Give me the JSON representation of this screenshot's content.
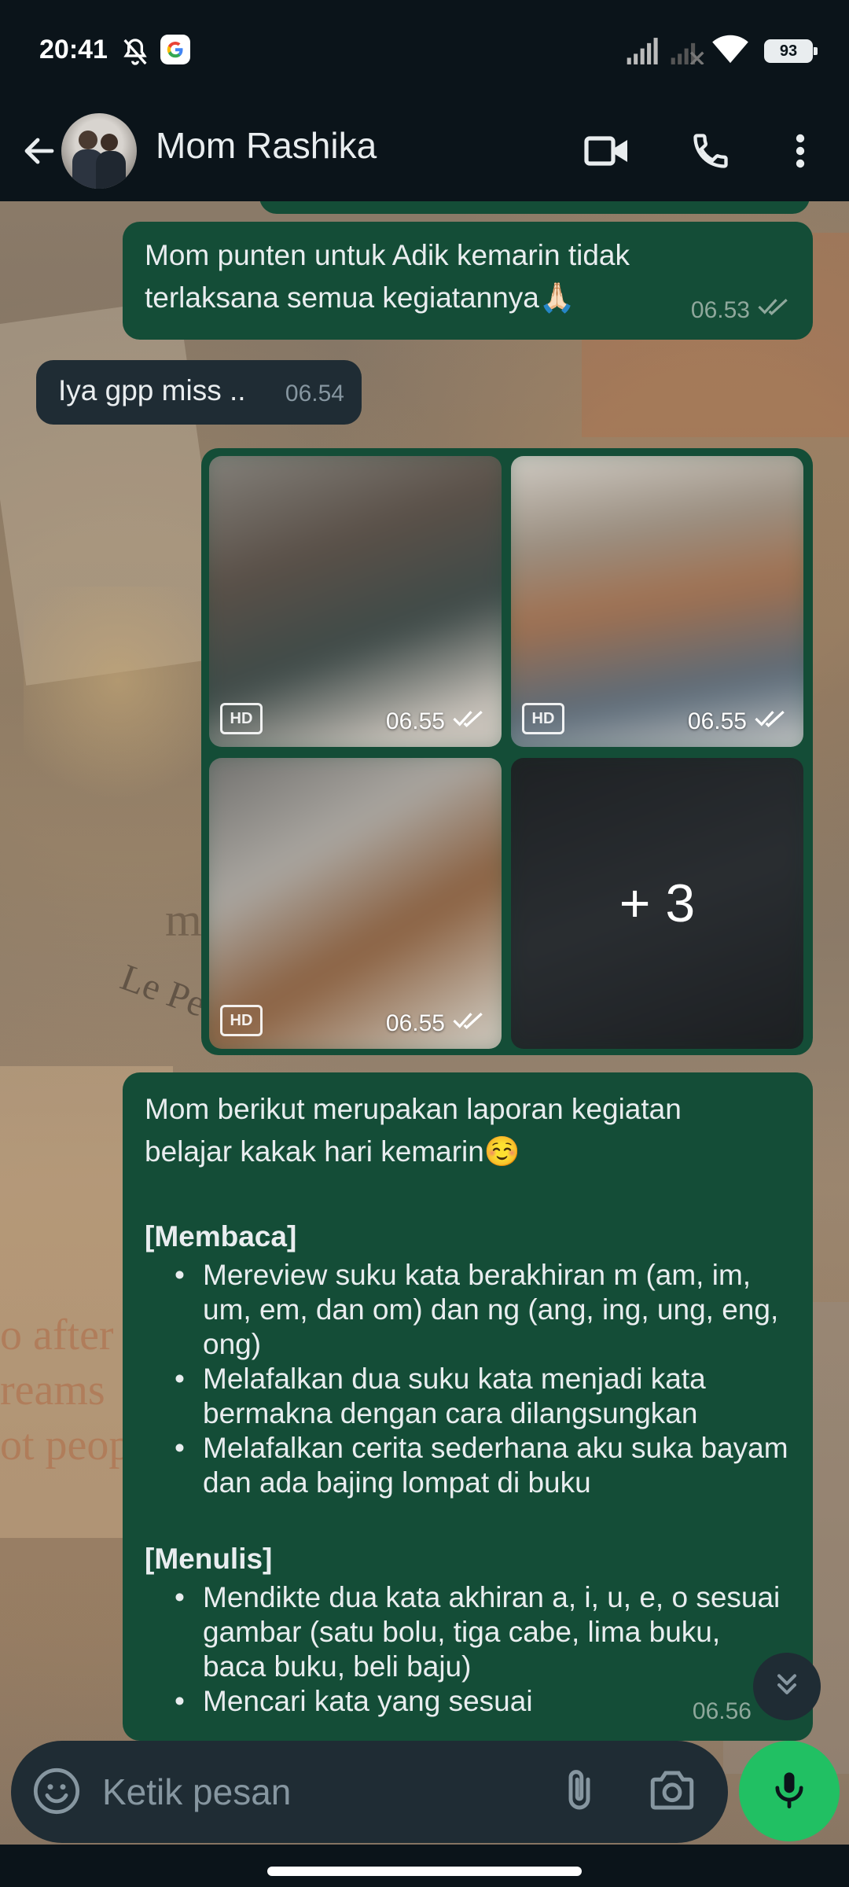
{
  "status_bar": {
    "time": "20:41",
    "battery": "93",
    "icons": [
      "mute-notifications-icon",
      "google-icon",
      "signal-icon",
      "signal-no-service-icon",
      "wifi-icon",
      "battery-icon"
    ]
  },
  "header": {
    "contact_name": "Mom Rashika",
    "icons": [
      "back-arrow-icon",
      "video-call-icon",
      "voice-call-icon",
      "more-options-icon"
    ]
  },
  "messages": [
    {
      "direction": "outgoing",
      "lines": [
        "Mom punten untuk Adik kemarin tidak",
        "terlaksana semua kegiatannya🙏🏻"
      ],
      "time": "06.53",
      "status": "read"
    },
    {
      "direction": "incoming",
      "text": "Iya gpp miss ..",
      "time": "06.54"
    }
  ],
  "media": {
    "tiles": [
      {
        "badge": "HD",
        "time": "06.55"
      },
      {
        "badge": "HD",
        "time": "06.55"
      },
      {
        "badge": "HD",
        "time": "06.55"
      }
    ],
    "more_count": "+ 3"
  },
  "report": {
    "intro_lines": [
      "Mom berikut merupakan laporan kegiatan",
      "belajar kakak hari kemarin☺️"
    ],
    "sections": [
      {
        "title": "[Membaca]",
        "items": [
          "Mereview suku kata berakhiran m (am, im, um, em, dan om) dan ng (ang, ing, ung, eng, ong)",
          "Melafalkan dua suku kata menjadi kata bermakna dengan cara dilangsungkan",
          "Melafalkan cerita sederhana aku suka bayam dan ada bajing lompat di buku"
        ]
      },
      {
        "title": "[Menulis]",
        "items": [
          "Mendikte dua kata akhiran a, i, u, e, o sesuai gambar (satu bolu, tiga cabe, lima buku, baca buku, beli baju)",
          "Mencari kata yang sesuai"
        ]
      }
    ],
    "time": "06.56"
  },
  "wallpaper_text": [
    "mis",
    "Le Petit P",
    "o after",
    "reams",
    "ot peopl"
  ],
  "composer": {
    "placeholder": "Ketik pesan",
    "icons": [
      "emoji-icon",
      "attach-icon",
      "camera-icon",
      "mic-icon"
    ]
  },
  "colors": {
    "outgoing_bubble": "#144d37",
    "incoming_bubble": "#1f2c34",
    "app_bar": "#0b141a",
    "mic_button": "#21c063"
  }
}
